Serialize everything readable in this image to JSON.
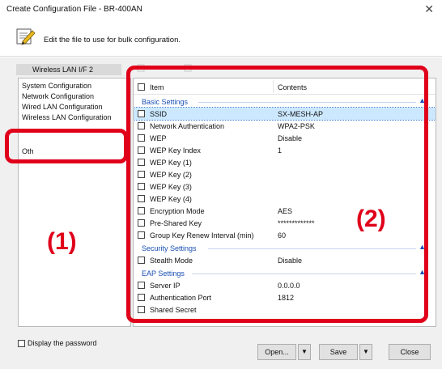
{
  "window": {
    "title": "Create Configuration File - BR-400AN",
    "close_glyph": "✕"
  },
  "banner": {
    "description": "Edit the file to use for bulk configuration."
  },
  "tree": {
    "items": [
      "System Configuration",
      "Network Configuration",
      "Wired LAN Configuration",
      "Wireless LAN Configuration"
    ],
    "subitem": "Wireless LAN I/F 2",
    "partial_item": "Oth"
  },
  "list": {
    "header_item": "Item",
    "header_contents": "Contents",
    "groups": {
      "basic": "Basic Settings",
      "security": "Security Settings",
      "eap": "EAP Settings"
    },
    "rows": [
      {
        "label": "SSID",
        "value": "SX-MESH-AP"
      },
      {
        "label": "Network Authentication",
        "value": "WPA2-PSK"
      },
      {
        "label": "WEP",
        "value": "Disable"
      },
      {
        "label": "WEP Key Index",
        "value": "1"
      },
      {
        "label": "WEP Key (1)",
        "value": ""
      },
      {
        "label": "WEP Key (2)",
        "value": ""
      },
      {
        "label": "WEP Key (3)",
        "value": ""
      },
      {
        "label": "WEP Key (4)",
        "value": ""
      },
      {
        "label": "Encryption Mode",
        "value": "AES"
      },
      {
        "label": "Pre-Shared Key",
        "value": "*************"
      },
      {
        "label": "Group Key Renew Interval (min)",
        "value": "60"
      },
      {
        "label": "Stealth Mode",
        "value": "Disable"
      },
      {
        "label": "Server IP",
        "value": "0.0.0.0"
      },
      {
        "label": "Authentication Port",
        "value": "1812"
      },
      {
        "label": "Shared Secret",
        "value": ""
      }
    ]
  },
  "footer": {
    "display_password": "Display the password",
    "open_label": "Open...",
    "save_label": "Save",
    "close_label": "Close"
  },
  "annotations": {
    "one": "(1)",
    "two": "(2)"
  },
  "colors": {
    "annotation": "#e0001a",
    "group_label": "#1a4fb4",
    "selection": "#cce8ff"
  }
}
